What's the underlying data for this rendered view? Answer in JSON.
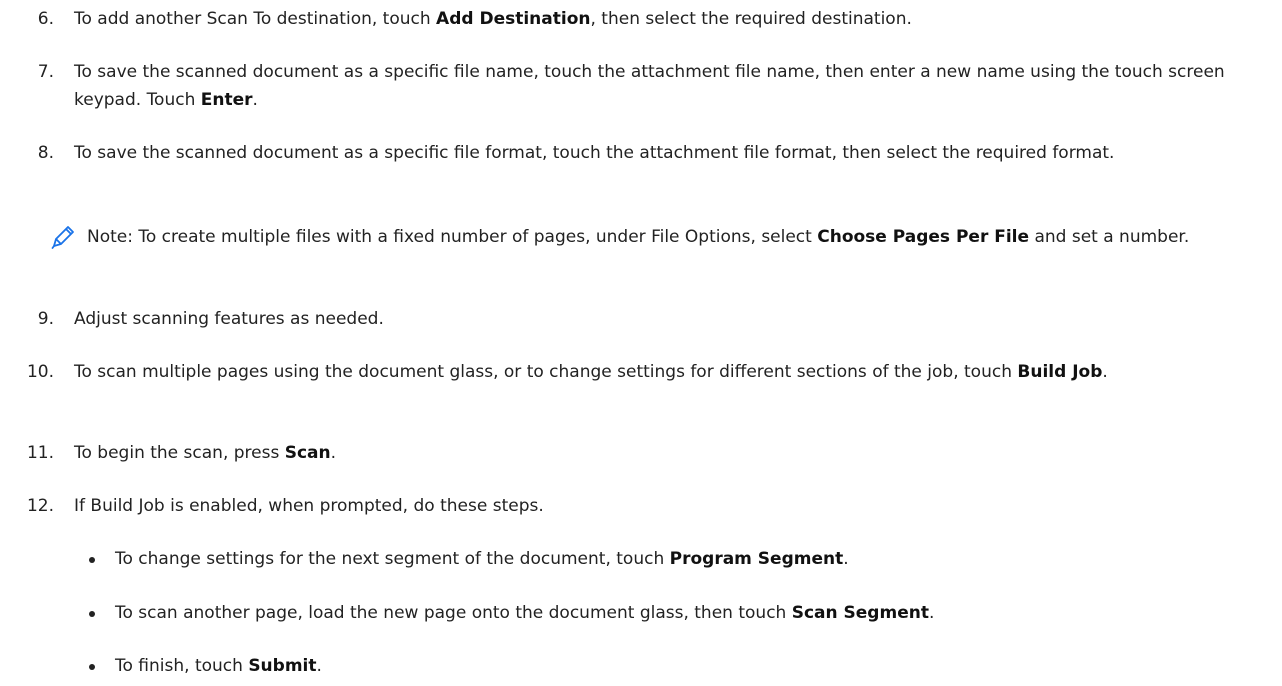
{
  "steps": [
    {
      "num": "6.",
      "pre": "To add another Scan To destination, touch ",
      "bold": "Add Destination",
      "post": ", then select the required destination."
    },
    {
      "num": "7.",
      "pre": "To save the scanned document as a specific file name, touch the attachment file name, then enter a new name using the touch screen keypad. Touch ",
      "bold": "Enter",
      "post": "."
    },
    {
      "num": "8.",
      "text": "To save the scanned document as a specific file format, touch the attachment file format, then select the required format."
    },
    {
      "num": "9.",
      "text": "Adjust scanning features as needed."
    },
    {
      "num": "10.",
      "pre": "To scan multiple pages using the document glass, or to change settings for different sections of the job, touch ",
      "bold": "Build Job",
      "post": "."
    },
    {
      "num": "11.",
      "pre": "To begin the scan, press ",
      "bold": "Scan",
      "post": "."
    },
    {
      "num": "12.",
      "text": "If Build Job is enabled, when prompted, do these steps."
    }
  ],
  "note": {
    "icon": "pencil-icon",
    "pre": "Note: To create multiple files with a fixed number of pages, under File Options, select ",
    "bold": "Choose Pages Per File",
    "post": " and set a number."
  },
  "bullets": [
    {
      "pre": "To change settings for the next segment of the document, touch ",
      "bold": "Program Segment",
      "post": "."
    },
    {
      "pre": "To scan another page, load the new page onto the document glass, then touch ",
      "bold": "Scan Segment",
      "post": "."
    },
    {
      "pre": "To finish, touch ",
      "bold": "Submit",
      "post": "."
    }
  ],
  "colors": {
    "text": "#222222",
    "icon": "#1a73e8"
  }
}
